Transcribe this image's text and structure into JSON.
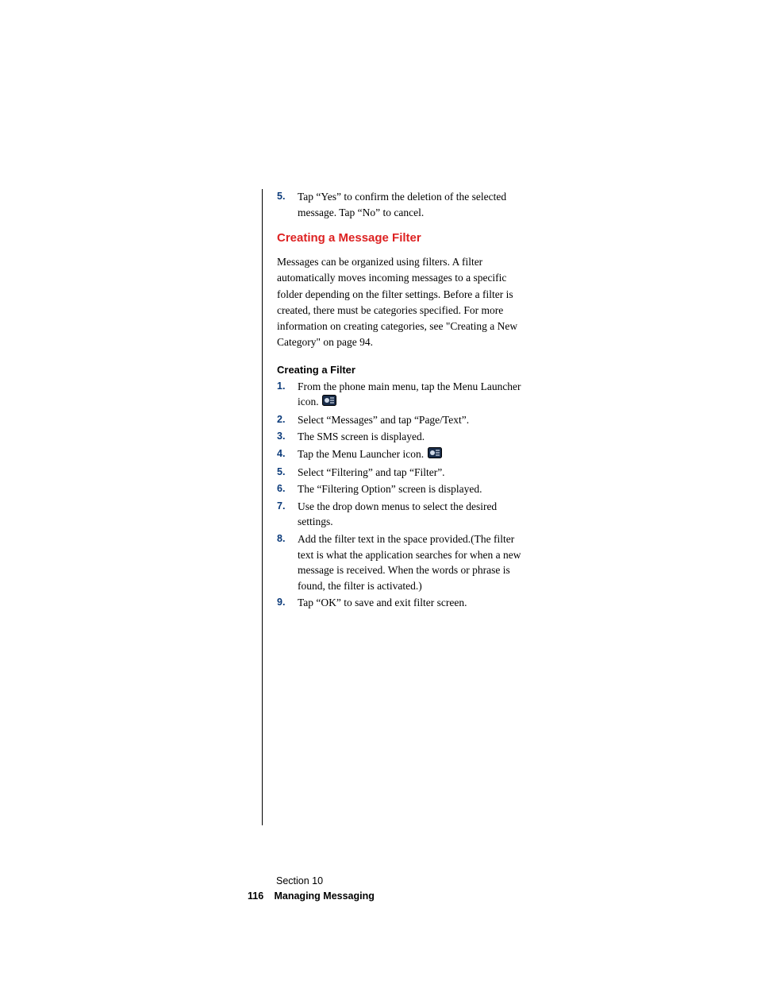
{
  "topList": {
    "items": [
      {
        "num": "5.",
        "text": "Tap “Yes” to confirm the deletion of the selected message. Tap “No” to cancel."
      }
    ]
  },
  "sectionTitle": "Creating a Message Filter",
  "intro": "Messages can be organized using filters. A filter automatically moves incoming messages to a specific folder depending on the filter settings. Before a filter is created, there must be categories specified. For more information on creating categories, see \"Creating a New Category\" on page 94.",
  "subTitle": "Creating a Filter",
  "steps": [
    {
      "num": "1.",
      "text_pre": "From the phone main menu, tap the Menu Launcher icon. ",
      "icon": true,
      "text_post": ""
    },
    {
      "num": "2.",
      "text_pre": "Select “Messages” and tap “Page/Text”.",
      "icon": false,
      "text_post": ""
    },
    {
      "num": "3.",
      "text_pre": "The SMS screen is displayed.",
      "icon": false,
      "text_post": ""
    },
    {
      "num": "4.",
      "text_pre": "Tap the Menu Launcher icon. ",
      "icon": true,
      "text_post": ""
    },
    {
      "num": "5.",
      "text_pre": "Select “Filtering” and tap “Filter”.",
      "icon": false,
      "text_post": ""
    },
    {
      "num": "6.",
      "text_pre": "The “Filtering Option” screen is displayed.",
      "icon": false,
      "text_post": ""
    },
    {
      "num": "7.",
      "text_pre": "Use the drop down menus to select the desired settings.",
      "icon": false,
      "text_post": ""
    },
    {
      "num": "8.",
      "text_pre": "Add the filter text in the space provided.(The filter text is what the application searches for when a new message is received. When the words or phrase is found, the filter is activated.)",
      "icon": false,
      "text_post": ""
    },
    {
      "num": "9.",
      "text_pre": "Tap “OK” to save and exit filter screen.",
      "icon": false,
      "text_post": ""
    }
  ],
  "footer": {
    "sectionLine": "Section 10",
    "pageNumber": "116",
    "chapter": "Managing Messaging"
  },
  "iconName": "menu-launcher-icon"
}
